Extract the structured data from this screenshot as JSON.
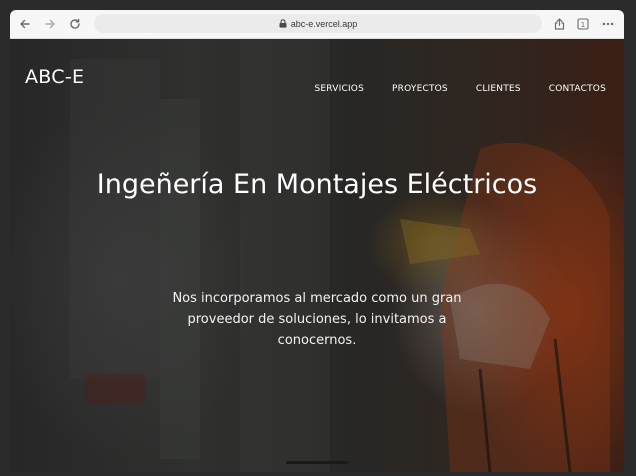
{
  "browser": {
    "url": "abc-e.vercel.app",
    "icons": {
      "back": "arrow-left-icon",
      "forward": "arrow-right-icon",
      "reload": "reload-icon",
      "lock": "lock-icon",
      "share": "share-icon",
      "tabs": "tabs-icon",
      "more": "more-icon"
    },
    "tabs_count": "1"
  },
  "site": {
    "brand": "ABC-E",
    "nav": [
      {
        "label": "SERVICIOS"
      },
      {
        "label": "PROYECTOS"
      },
      {
        "label": "CLIENTES"
      },
      {
        "label": "CONTACTOS"
      }
    ],
    "hero": {
      "title": "Ingeñería En Montajes Eléctricos",
      "subtitle": "Nos incorporamos al mercado como un gran proveedor de soluciones, lo invitamos a conocernos."
    }
  },
  "colors": {
    "accent_orange": "#d95420",
    "text": "#ffffff",
    "toolbar": "#f7f7f7"
  }
}
